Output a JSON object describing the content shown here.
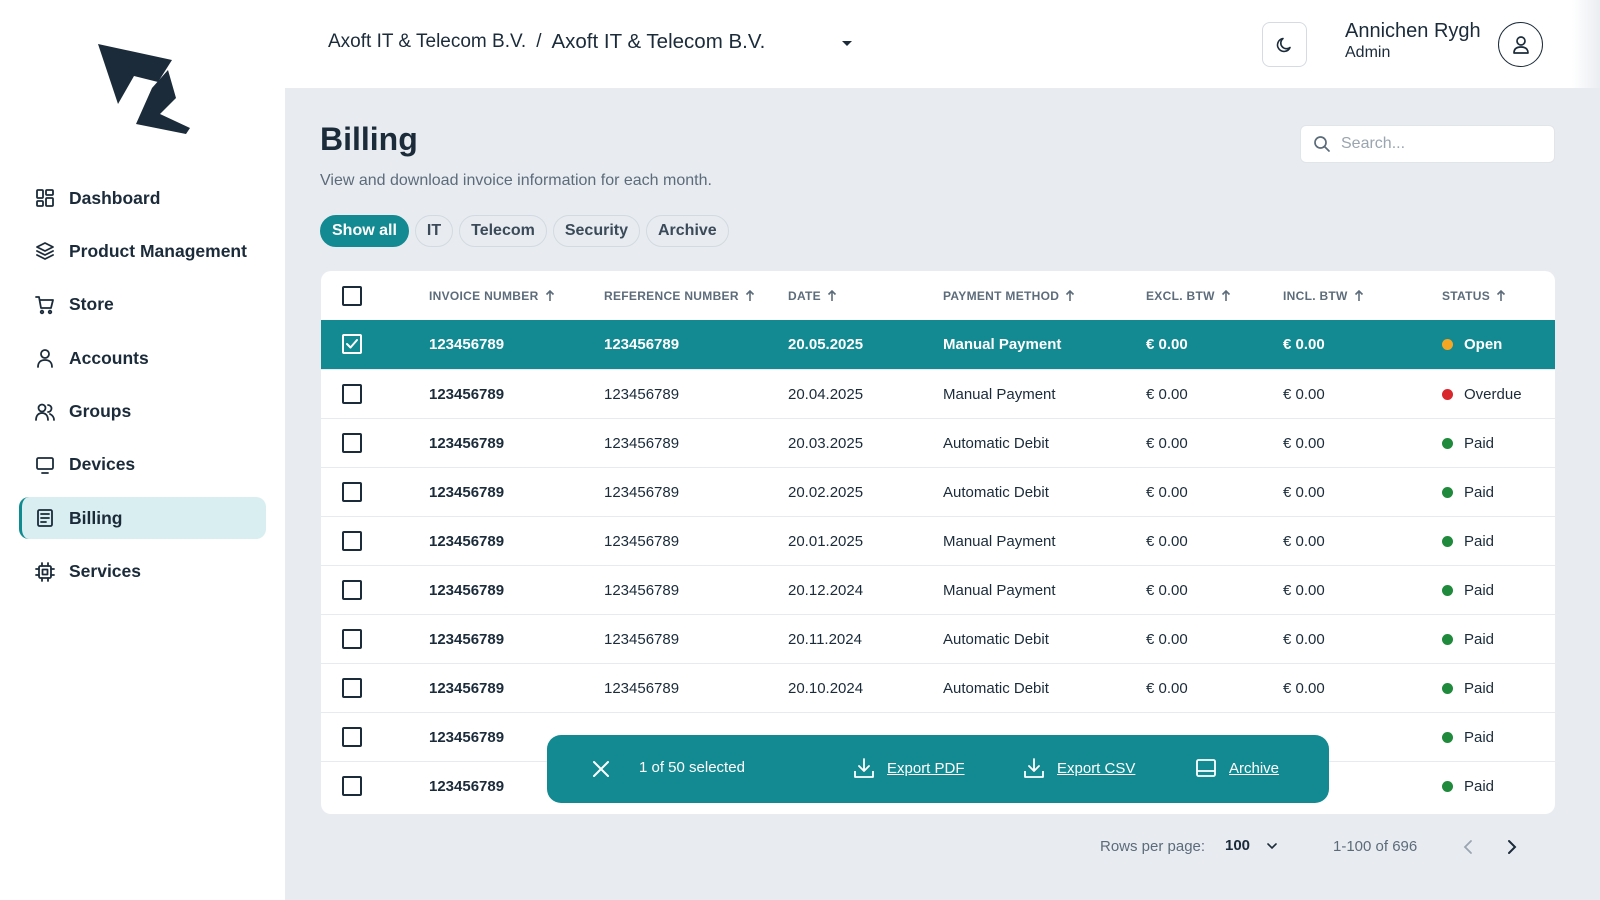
{
  "header": {
    "breadcrumb_parent": "Axoft IT & Telecom B.V.",
    "breadcrumb_separator": "/",
    "breadcrumb_current": "Axoft IT & Telecom B.V.",
    "user_name": "Annichen Rygh",
    "user_role": "Admin",
    "theme_icon": "moon-icon",
    "avatar_icon": "user-icon"
  },
  "sidebar": {
    "items": [
      {
        "label": "Dashboard",
        "icon": "dashboard-icon",
        "active": false
      },
      {
        "label": "Product Management",
        "icon": "layers-icon",
        "active": false
      },
      {
        "label": "Store",
        "icon": "cart-icon",
        "active": false
      },
      {
        "label": "Accounts",
        "icon": "user-icon",
        "active": false
      },
      {
        "label": "Groups",
        "icon": "users-icon",
        "active": false
      },
      {
        "label": "Devices",
        "icon": "monitor-icon",
        "active": false
      },
      {
        "label": "Billing",
        "icon": "receipt-icon",
        "active": true
      },
      {
        "label": "Services",
        "icon": "chip-icon",
        "active": false
      }
    ]
  },
  "main": {
    "title": "Billing",
    "subtitle": "View and download invoice information for each month.",
    "search_placeholder": "Search...",
    "filters": [
      {
        "label": "Show all",
        "active": true
      },
      {
        "label": "IT",
        "active": false
      },
      {
        "label": "Telecom",
        "active": false
      },
      {
        "label": "Security",
        "active": false
      },
      {
        "label": "Archive",
        "active": false
      }
    ]
  },
  "table": {
    "columns": [
      "INVOICE NUMBER",
      "REFERENCE NUMBER",
      "DATE",
      "PAYMENT METHOD",
      "EXCL. BTW",
      "INCL. BTW",
      "STATUS"
    ],
    "rows": [
      {
        "invoice": "123456789",
        "reference": "123456789",
        "date": "20.05.2025",
        "method": "Manual Payment",
        "excl": "€ 0.00",
        "incl": "€ 0.00",
        "status": "Open",
        "status_color": "#f5a623",
        "selected": true
      },
      {
        "invoice": "123456789",
        "reference": "123456789",
        "date": "20.04.2025",
        "method": "Manual Payment",
        "excl": "€ 0.00",
        "incl": "€ 0.00",
        "status": "Overdue",
        "status_color": "#d9272e",
        "selected": false
      },
      {
        "invoice": "123456789",
        "reference": "123456789",
        "date": "20.03.2025",
        "method": "Automatic Debit",
        "excl": "€ 0.00",
        "incl": "€ 0.00",
        "status": "Paid",
        "status_color": "#1f8a3b",
        "selected": false
      },
      {
        "invoice": "123456789",
        "reference": "123456789",
        "date": "20.02.2025",
        "method": "Automatic Debit",
        "excl": "€ 0.00",
        "incl": "€ 0.00",
        "status": "Paid",
        "status_color": "#1f8a3b",
        "selected": false
      },
      {
        "invoice": "123456789",
        "reference": "123456789",
        "date": "20.01.2025",
        "method": "Manual Payment",
        "excl": "€ 0.00",
        "incl": "€ 0.00",
        "status": "Paid",
        "status_color": "#1f8a3b",
        "selected": false
      },
      {
        "invoice": "123456789",
        "reference": "123456789",
        "date": "20.12.2024",
        "method": "Manual Payment",
        "excl": "€ 0.00",
        "incl": "€ 0.00",
        "status": "Paid",
        "status_color": "#1f8a3b",
        "selected": false
      },
      {
        "invoice": "123456789",
        "reference": "123456789",
        "date": "20.11.2024",
        "method": "Automatic Debit",
        "excl": "€ 0.00",
        "incl": "€ 0.00",
        "status": "Paid",
        "status_color": "#1f8a3b",
        "selected": false
      },
      {
        "invoice": "123456789",
        "reference": "123456789",
        "date": "20.10.2024",
        "method": "Automatic Debit",
        "excl": "€ 0.00",
        "incl": "€ 0.00",
        "status": "Paid",
        "status_color": "#1f8a3b",
        "selected": false
      },
      {
        "invoice": "123456789",
        "reference": "",
        "date": "",
        "method": "",
        "excl": "",
        "incl": "",
        "status": "Paid",
        "status_color": "#1f8a3b",
        "selected": false
      },
      {
        "invoice": "123456789",
        "reference": "",
        "date": "",
        "method": "",
        "excl": "",
        "incl": "",
        "status": "Paid",
        "status_color": "#1f8a3b",
        "selected": false
      }
    ]
  },
  "action_bar": {
    "count_text": "1 of 50 selected",
    "export_pdf": "Export PDF",
    "export_csv": "Export CSV",
    "archive": "Archive"
  },
  "pagination": {
    "rows_per_page_label": "Rows per page:",
    "rows_per_page_value": "100",
    "range_text": "1-100 of 696"
  },
  "colors": {
    "accent": "#138a91",
    "active_nav_bg": "#d9eef0",
    "status_open": "#f5a623",
    "status_overdue": "#d9272e",
    "status_paid": "#1f8a3b"
  }
}
